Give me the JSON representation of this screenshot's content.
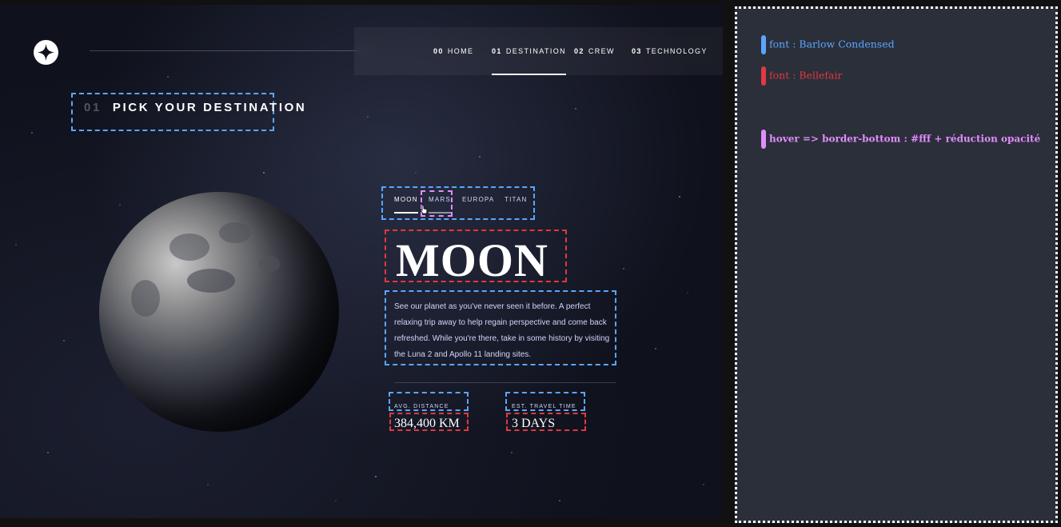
{
  "header": {
    "nav": [
      {
        "num": "00",
        "label": "HOME",
        "active": false
      },
      {
        "num": "01",
        "label": "DESTINATION",
        "active": true
      },
      {
        "num": "02",
        "label": "CREW",
        "active": false
      },
      {
        "num": "03",
        "label": "TECHNOLOGY",
        "active": false
      }
    ]
  },
  "page": {
    "section_num": "01",
    "section_title": "PICK YOUR DESTINATION"
  },
  "destination": {
    "tabs": [
      {
        "label": "MOON",
        "state": "active"
      },
      {
        "label": "MARS",
        "state": "hover"
      },
      {
        "label": "EUROPA",
        "state": "default"
      },
      {
        "label": "TITAN",
        "state": "default"
      }
    ],
    "name": "MOON",
    "description": "See our planet as you've never seen it before. A perfect relaxing trip away to help regain perspective and come back refreshed. While you're there, take in some history by visiting the Luna 2 and Apollo 11 landing sites.",
    "stats": [
      {
        "label": "AVG. DISTANCE",
        "value": "384,400 KM"
      },
      {
        "label": "EST. TRAVEL TIME",
        "value": "3 DAYS"
      }
    ]
  },
  "notes": [
    {
      "text": "font : Barlow Condensed",
      "color": "#5aa6ff"
    },
    {
      "text": "font : Bellefair",
      "color": "#e0393f"
    },
    {
      "text": "hover => border-bottom : #fff + réduction opacité",
      "color": "#e28cff"
    }
  ],
  "colors": {
    "background": "#0f111c",
    "accent_text": "#d0d6f9",
    "annotation_blue": "#5aa6ff",
    "annotation_red": "#e0393f",
    "annotation_pink": "#e28cff",
    "notes_panel": "#2b2f3a"
  },
  "icons": {
    "logo": "star-logo-icon",
    "cursor": "hand-cursor-icon"
  }
}
